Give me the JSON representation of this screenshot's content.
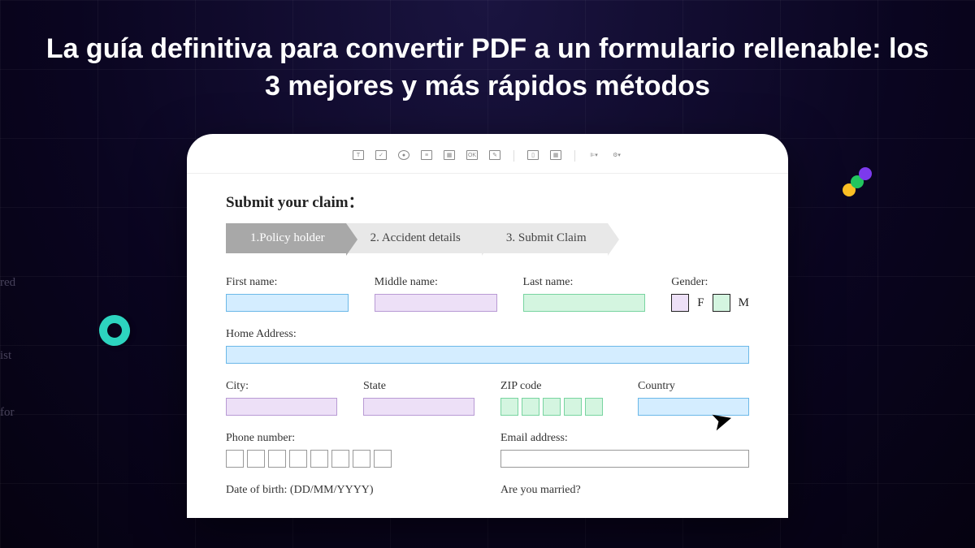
{
  "headline": "La guía definitiva para convertir PDF a un formulario rellenable: los 3 mejores y más rápidos métodos",
  "form": {
    "title": "Submit your claim：",
    "steps": [
      "1.Policy holder",
      "2. Accident details",
      "3. Submit Claim"
    ],
    "labels": {
      "first_name": "First name:",
      "middle_name": "Middle name:",
      "last_name": "Last name:",
      "gender": "Gender:",
      "gender_f": "F",
      "gender_m": "M",
      "home_address": "Home Address:",
      "city": "City:",
      "state": "State",
      "zip": "ZIP code",
      "country": "Country",
      "phone": "Phone number:",
      "email": "Email address:",
      "dob": "Date of birth: (DD/MM/YYYY)",
      "married": "Are you married?"
    }
  },
  "left_text": {
    "a": "red",
    "b": "ist",
    "c": "for"
  }
}
